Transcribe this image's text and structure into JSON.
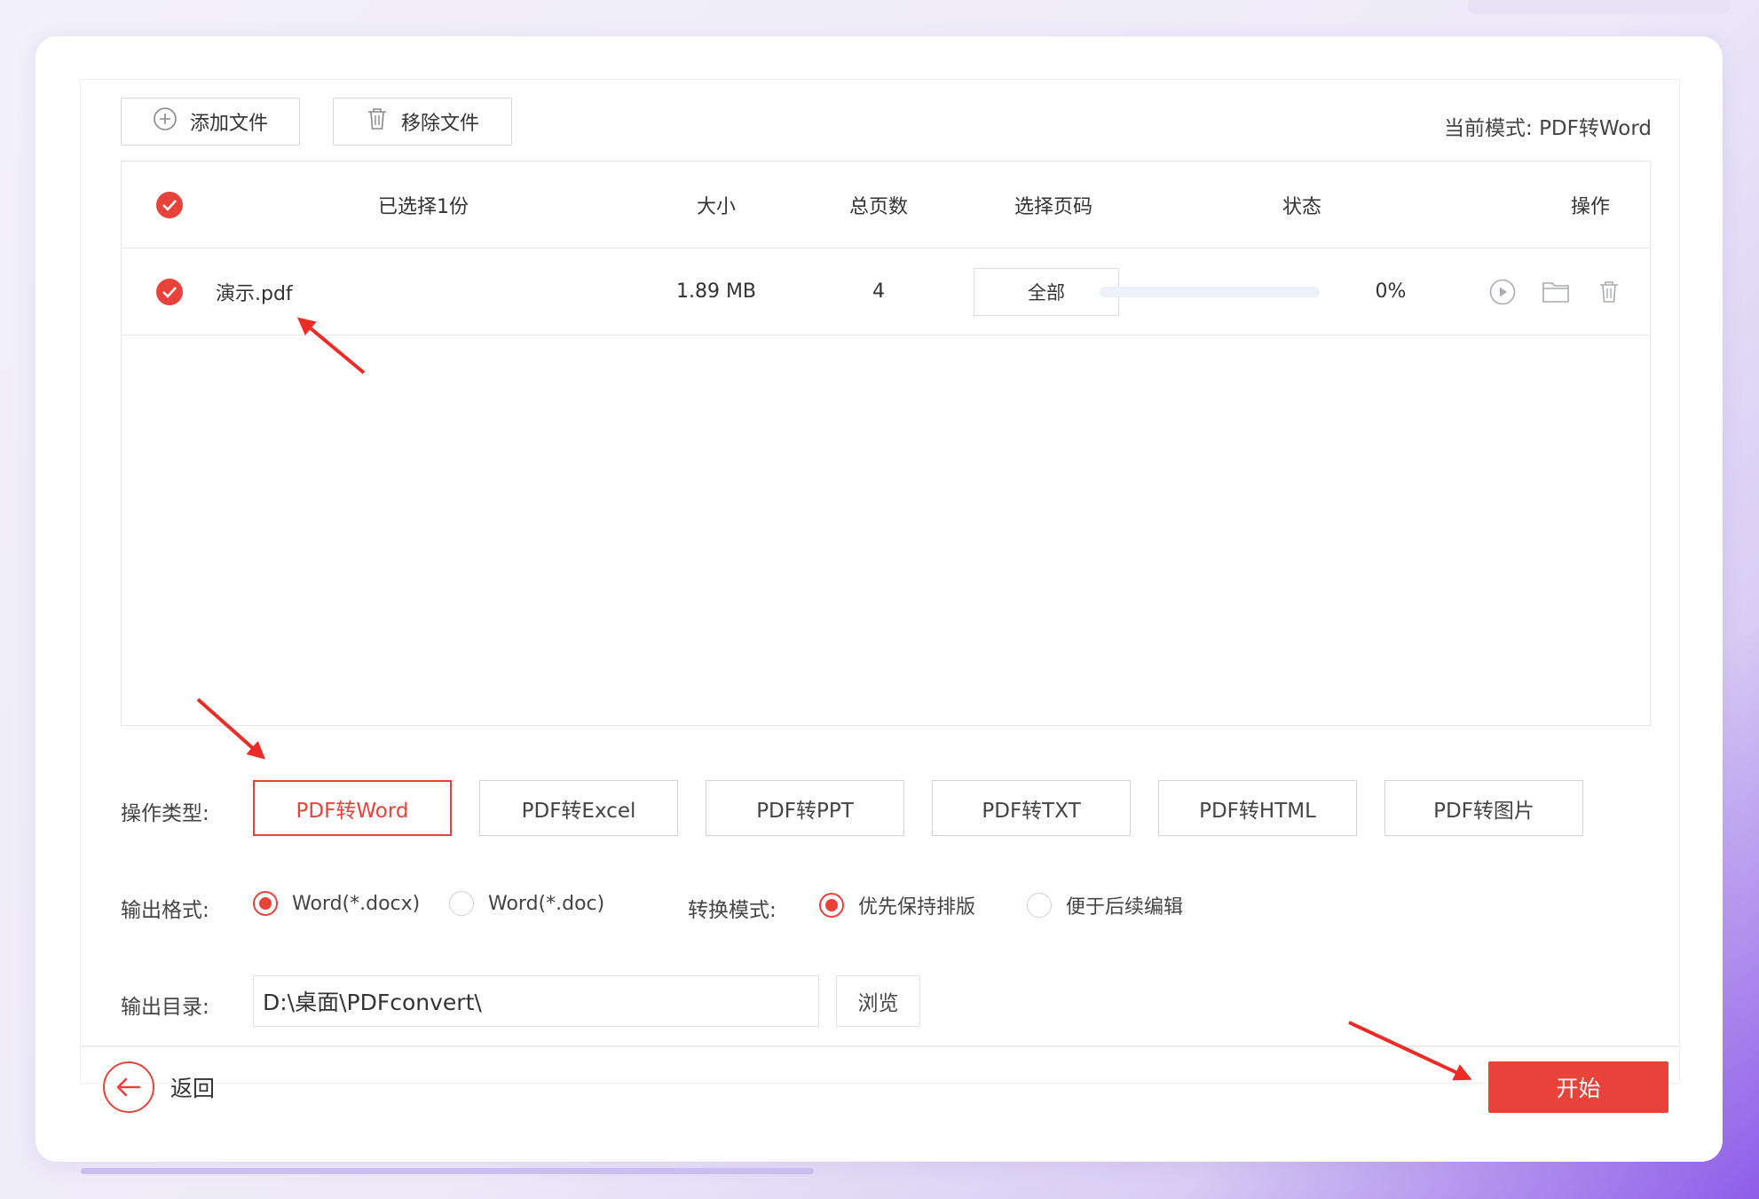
{
  "toolbar": {
    "add_label": "添加文件",
    "remove_label": "移除文件",
    "mode_prefix": "当前模式:",
    "mode_value": "PDF转Word"
  },
  "table": {
    "headers": {
      "selected": "已选择1份",
      "size": "大小",
      "pages": "总页数",
      "page_select": "选择页码",
      "status": "状态",
      "actions": "操作"
    },
    "rows": [
      {
        "name": "演示.pdf",
        "size": "1.89 MB",
        "pages": "4",
        "page_select": "全部",
        "progress_label": "0%",
        "progress": 0
      }
    ]
  },
  "options": {
    "type_label": "操作类型:",
    "types": [
      "PDF转Word",
      "PDF转Excel",
      "PDF转PPT",
      "PDF转TXT",
      "PDF转HTML",
      "PDF转图片"
    ],
    "active_type": "PDF转Word",
    "format_label": "输出格式:",
    "formats": [
      "Word(*.docx)",
      "Word(*.doc)"
    ],
    "selected_format": "Word(*.docx)",
    "mode_label": "转换模式:",
    "modes": [
      "优先保持排版",
      "便于后续编辑"
    ],
    "selected_mode": "优先保持排版",
    "dir_label": "输出目录:",
    "dir_value": "D:\\桌面\\PDFconvert\\",
    "browse_label": "浏览"
  },
  "footer": {
    "back_label": "返回",
    "start_label": "开始"
  },
  "colors": {
    "accent": "#e8423a",
    "border": "#d2d3da"
  }
}
